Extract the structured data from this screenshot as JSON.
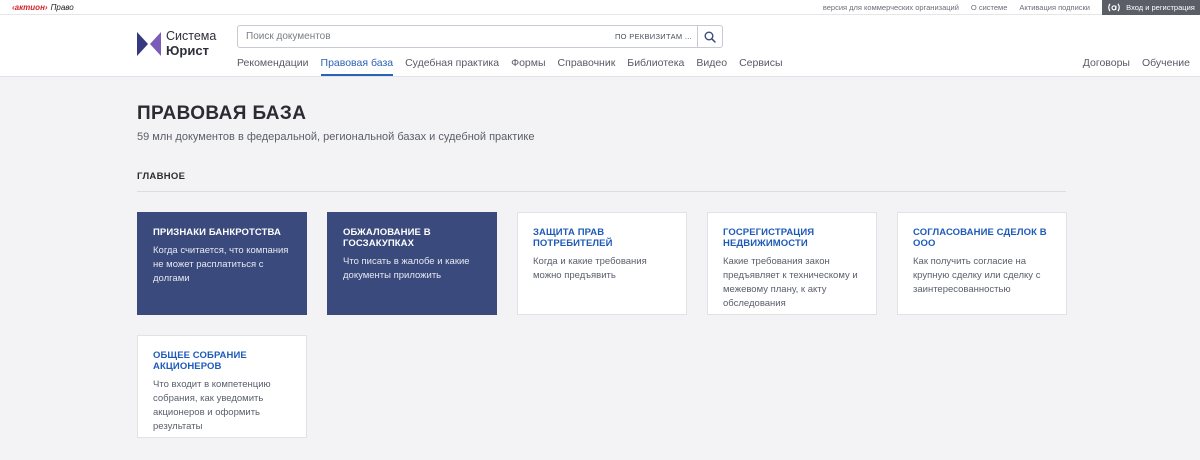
{
  "topbar": {
    "brand": {
      "logo_text": "актион",
      "product": "Право"
    },
    "links": [
      "версия для коммерческих организаций",
      "О системе",
      "Активация подписки"
    ],
    "login_label": "Вход и регистрация"
  },
  "header": {
    "logo": {
      "line1": "Система",
      "line2": "Юрист"
    },
    "search": {
      "placeholder": "Поиск документов",
      "by_details": "ПО РЕКВИЗИТАМ ..."
    },
    "nav": {
      "items": [
        "Рекомендации",
        "Правовая база",
        "Судебная практика",
        "Формы",
        "Справочник",
        "Библиотека",
        "Видео",
        "Сервисы"
      ],
      "active": "Правовая база",
      "right": [
        "Договоры",
        "Обучение"
      ]
    }
  },
  "main": {
    "title": "ПРАВОВАЯ БАЗА",
    "subtitle": "59 млн документов в федеральной, региональной базах и судебной практике",
    "section_label": "ГЛАВНОЕ",
    "cards": [
      {
        "title": "ПРИЗНАКИ БАНКРОТСТВА",
        "description": "Когда считается, что компания не может расплатиться с долгами",
        "variant": "dark"
      },
      {
        "title": "ОБЖАЛОВАНИЕ В ГОСЗАКУПКАХ",
        "description": "Что писать в жалобе и какие документы приложить",
        "variant": "dark"
      },
      {
        "title": "ЗАЩИТА ПРАВ ПОТРЕБИТЕЛЕЙ",
        "description": "Когда и какие требования можно предъявить",
        "variant": "light"
      },
      {
        "title": "ГОСРЕГИСТРАЦИЯ НЕДВИЖИМОСТИ",
        "description": "Какие требования закон предъявляет к техническому и межевому плану, к акту обследования",
        "variant": "light"
      },
      {
        "title": "СОГЛАСОВАНИЕ СДЕЛОК В ООО",
        "description": "Как получить согласие на крупную сделку или сделку с заинтересованностью",
        "variant": "light"
      },
      {
        "title": "ОБЩЕЕ СОБРАНИЕ АКЦИОНЕРОВ",
        "description": "Что входит в компетенцию собрания, как уведомить акционеров и оформить результаты",
        "variant": "light"
      }
    ]
  },
  "colors": {
    "accent": "#2a62b5",
    "card_dark": "#3a4a7c",
    "card_title_light": "#1e5bb8",
    "brand_red": "#d3232a",
    "page_bg": "#f3f3f5"
  }
}
